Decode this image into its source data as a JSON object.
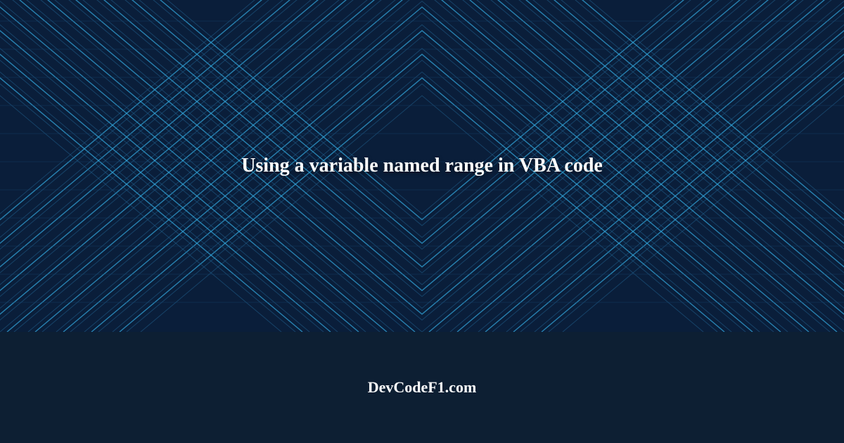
{
  "hero": {
    "title": "Using a variable named range in VBA code"
  },
  "footer": {
    "site_name": "DevCodeF1.com"
  },
  "colors": {
    "bg_dark": "#0d1f33",
    "pattern_base": "#0a1e3a",
    "line_bright": "#2fa3d8",
    "line_mid": "#1d5e8c"
  }
}
